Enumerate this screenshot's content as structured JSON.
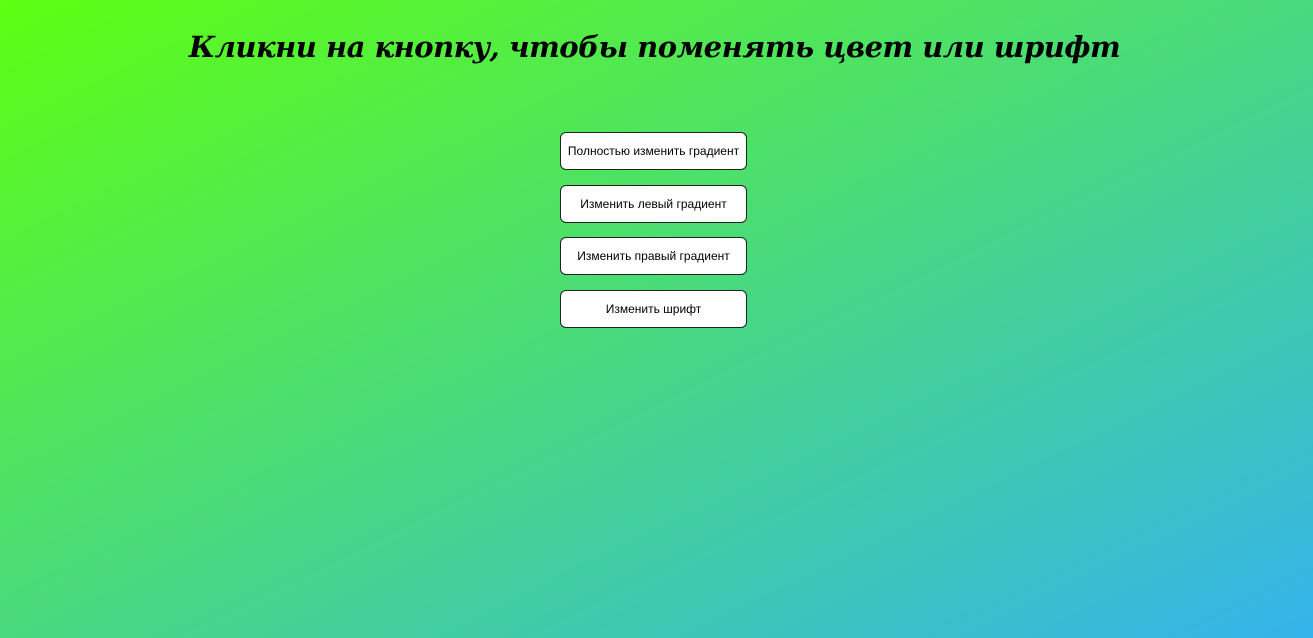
{
  "page": {
    "heading": "Кликни на кнопку, чтобы поменять цвет или шрифт",
    "colors": {
      "gradient_start": "#5dff11",
      "gradient_end": "#35b3ec",
      "button_background": "#ffffff"
    }
  },
  "buttons": [
    {
      "label": "Полностью изменить градиент"
    },
    {
      "label": "Изменить левый градиент"
    },
    {
      "label": "Изменить правый градиент"
    },
    {
      "label": "Изменить шрифт"
    }
  ]
}
